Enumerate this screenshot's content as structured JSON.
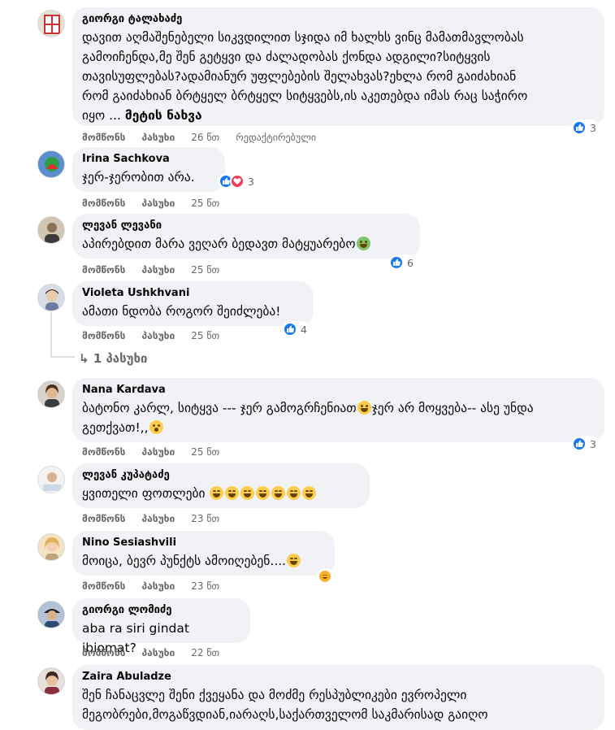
{
  "actions": {
    "like": "მომწონს",
    "reply": "პასუხი"
  },
  "comments": [
    {
      "author": "გიორგი ტალახაძე",
      "lines": [
        "დავით აღმაშენებელი სიკვდილით სჯიდა იმ ხალხს ვინც მამათმავლობას",
        "გამოიჩენდა,მე შენ გეტყვი და ძალადობას ქონდა ადგილი?სიტყვის",
        "თავისუფლებას?ადამიანურ უფლებების შელახვას?ეხლა რომ გაიძახიან",
        "რომ გაიძახიან ბრტყელ ბრტყელ სიტყვებს,ის აკეთებდა იმას რაც საჭირო"
      ],
      "last_line": "იყო ...",
      "see_more": "მეტის ნახვა",
      "time": "26 წთ",
      "edited": "რედაქტირებული",
      "reaction_count": "3"
    },
    {
      "author": "Irina Sachkova",
      "text": "ჯერ-ჯერობით არა.",
      "time": "25 წთ",
      "reaction_count": "3"
    },
    {
      "author": "ლევან ლევანი",
      "text": "აპირებდით მარა ვეღარ ბედავთ მატყუარებო",
      "time": "25 წთ",
      "reaction_count": "6"
    },
    {
      "author": "Violeta Ushkhvani",
      "text": "ამათი ნდობა როგორ შეიძლება!",
      "time": "25 წთ",
      "reaction_count": "4"
    },
    {
      "author": "Nana Kardava",
      "line1a": "ბატონო კარლ, სიტყვა --- ჯერ გამოგრჩენიათ",
      "line1b": "ჯერ არ მოყვება-- ასე უნდა",
      "line2": "გეთქვათ!,,",
      "time": "25 წთ",
      "reaction_count": "3"
    },
    {
      "author": "ლევან კუპატაძე",
      "text": "ყვითელი ფოთლები",
      "time": "23 წთ"
    },
    {
      "author": "Nino Sesiashvili",
      "text": "მოიცა, ბევრ პუნქტს ამოიღებენ....",
      "time": "23 წთ"
    },
    {
      "author": "გიორგი ლომიძე",
      "text": "aba ra siri gindat ibiomat?",
      "time": "22 წთ"
    },
    {
      "author": "Zaira Abuladze",
      "line1": "შენ ჩანაცვლე შენი ქვეყანა და მოძმე რესპუბლიკები ევროპელი",
      "line2": "მეგობრები,მოგაწვდიან,იარაღს,საქართველომ საკმარისად გაიღო"
    }
  ],
  "replies_link": "1 პასუხი",
  "colors": {
    "like": "#1877f2",
    "love": "#f33e58",
    "bubble": "#f0f2f5",
    "meta": "#65676b"
  }
}
